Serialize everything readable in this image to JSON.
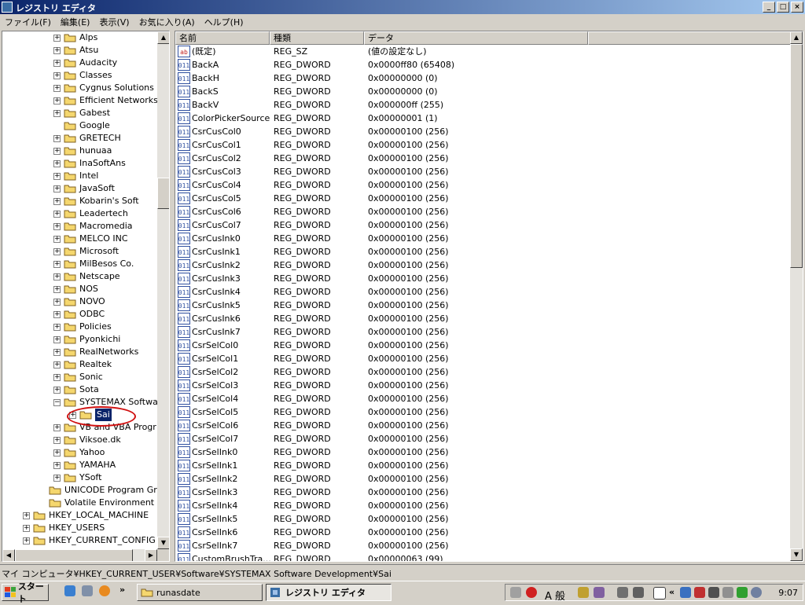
{
  "window": {
    "title": "レジストリ エディタ",
    "controls": [
      "_",
      "□",
      "×"
    ]
  },
  "menu": [
    "ファイル(F)",
    "編集(E)",
    "表示(V)",
    "お気に入り(A)",
    "ヘルプ(H)"
  ],
  "tree": {
    "items": [
      {
        "label": "Alps",
        "expandable": true
      },
      {
        "label": "Atsu",
        "expandable": true
      },
      {
        "label": "Audacity",
        "expandable": true
      },
      {
        "label": "Classes",
        "expandable": true
      },
      {
        "label": "Cygnus Solutions",
        "expandable": true
      },
      {
        "label": "Efficient Networks",
        "expandable": true
      },
      {
        "label": "Gabest",
        "expandable": true
      },
      {
        "label": "Google",
        "expandable": false
      },
      {
        "label": "GRETECH",
        "expandable": true
      },
      {
        "label": "hunuaa",
        "expandable": true
      },
      {
        "label": "InaSoftAns",
        "expandable": true
      },
      {
        "label": "Intel",
        "expandable": true
      },
      {
        "label": "JavaSoft",
        "expandable": true
      },
      {
        "label": "Kobarin's Soft",
        "expandable": true
      },
      {
        "label": "Leadertech",
        "expandable": true
      },
      {
        "label": "Macromedia",
        "expandable": true
      },
      {
        "label": "MELCO INC",
        "expandable": true
      },
      {
        "label": "Microsoft",
        "expandable": true
      },
      {
        "label": "MilBesos Co.",
        "expandable": true
      },
      {
        "label": "Netscape",
        "expandable": true
      },
      {
        "label": "NOS",
        "expandable": true
      },
      {
        "label": "NOVO",
        "expandable": true
      },
      {
        "label": "ODBC",
        "expandable": true
      },
      {
        "label": "Policies",
        "expandable": true
      },
      {
        "label": "Pyonkichi",
        "expandable": true
      },
      {
        "label": "RealNetworks",
        "expandable": true
      },
      {
        "label": "Realtek",
        "expandable": true
      },
      {
        "label": "Sonic",
        "expandable": true
      },
      {
        "label": "Sota",
        "expandable": true
      },
      {
        "label": "SYSTEMAX Softwa",
        "expandable": true,
        "expanded": true
      },
      {
        "label": "Sai",
        "expandable": true,
        "selected": true,
        "child": true
      },
      {
        "label": "VB and VBA Progr",
        "expandable": true
      },
      {
        "label": "Viksoe.dk",
        "expandable": true
      },
      {
        "label": "Yahoo",
        "expandable": true
      },
      {
        "label": "YAMAHA",
        "expandable": true
      },
      {
        "label": "YSoft",
        "expandable": true
      },
      {
        "label": "UNICODE Program Gro",
        "expandable": false,
        "level": 1
      },
      {
        "label": "Volatile Environment",
        "expandable": false,
        "level": 1
      },
      {
        "label": "HKEY_LOCAL_MACHINE",
        "expandable": true,
        "level": 0
      },
      {
        "label": "HKEY_USERS",
        "expandable": true,
        "level": 0
      },
      {
        "label": "HKEY_CURRENT_CONFIG",
        "expandable": true,
        "level": 0
      }
    ]
  },
  "columns": [
    "名前",
    "種類",
    "データ"
  ],
  "values": [
    {
      "name": "(既定)",
      "type": "REG_SZ",
      "data": "(値の設定なし)",
      "kind": "string"
    },
    {
      "name": "BackA",
      "type": "REG_DWORD",
      "data": "0x0000ff80 (65408)"
    },
    {
      "name": "BackH",
      "type": "REG_DWORD",
      "data": "0x00000000 (0)"
    },
    {
      "name": "BackS",
      "type": "REG_DWORD",
      "data": "0x00000000 (0)"
    },
    {
      "name": "BackV",
      "type": "REG_DWORD",
      "data": "0x000000ff (255)"
    },
    {
      "name": "ColorPickerSource",
      "type": "REG_DWORD",
      "data": "0x00000001 (1)"
    },
    {
      "name": "CsrCusCol0",
      "type": "REG_DWORD",
      "data": "0x00000100 (256)"
    },
    {
      "name": "CsrCusCol1",
      "type": "REG_DWORD",
      "data": "0x00000100 (256)"
    },
    {
      "name": "CsrCusCol2",
      "type": "REG_DWORD",
      "data": "0x00000100 (256)"
    },
    {
      "name": "CsrCusCol3",
      "type": "REG_DWORD",
      "data": "0x00000100 (256)"
    },
    {
      "name": "CsrCusCol4",
      "type": "REG_DWORD",
      "data": "0x00000100 (256)"
    },
    {
      "name": "CsrCusCol5",
      "type": "REG_DWORD",
      "data": "0x00000100 (256)"
    },
    {
      "name": "CsrCusCol6",
      "type": "REG_DWORD",
      "data": "0x00000100 (256)"
    },
    {
      "name": "CsrCusCol7",
      "type": "REG_DWORD",
      "data": "0x00000100 (256)"
    },
    {
      "name": "CsrCusInk0",
      "type": "REG_DWORD",
      "data": "0x00000100 (256)"
    },
    {
      "name": "CsrCusInk1",
      "type": "REG_DWORD",
      "data": "0x00000100 (256)"
    },
    {
      "name": "CsrCusInk2",
      "type": "REG_DWORD",
      "data": "0x00000100 (256)"
    },
    {
      "name": "CsrCusInk3",
      "type": "REG_DWORD",
      "data": "0x00000100 (256)"
    },
    {
      "name": "CsrCusInk4",
      "type": "REG_DWORD",
      "data": "0x00000100 (256)"
    },
    {
      "name": "CsrCusInk5",
      "type": "REG_DWORD",
      "data": "0x00000100 (256)"
    },
    {
      "name": "CsrCusInk6",
      "type": "REG_DWORD",
      "data": "0x00000100 (256)"
    },
    {
      "name": "CsrCusInk7",
      "type": "REG_DWORD",
      "data": "0x00000100 (256)"
    },
    {
      "name": "CsrSelCol0",
      "type": "REG_DWORD",
      "data": "0x00000100 (256)"
    },
    {
      "name": "CsrSelCol1",
      "type": "REG_DWORD",
      "data": "0x00000100 (256)"
    },
    {
      "name": "CsrSelCol2",
      "type": "REG_DWORD",
      "data": "0x00000100 (256)"
    },
    {
      "name": "CsrSelCol3",
      "type": "REG_DWORD",
      "data": "0x00000100 (256)"
    },
    {
      "name": "CsrSelCol4",
      "type": "REG_DWORD",
      "data": "0x00000100 (256)"
    },
    {
      "name": "CsrSelCol5",
      "type": "REG_DWORD",
      "data": "0x00000100 (256)"
    },
    {
      "name": "CsrSelCol6",
      "type": "REG_DWORD",
      "data": "0x00000100 (256)"
    },
    {
      "name": "CsrSelCol7",
      "type": "REG_DWORD",
      "data": "0x00000100 (256)"
    },
    {
      "name": "CsrSelInk0",
      "type": "REG_DWORD",
      "data": "0x00000100 (256)"
    },
    {
      "name": "CsrSelInk1",
      "type": "REG_DWORD",
      "data": "0x00000100 (256)"
    },
    {
      "name": "CsrSelInk2",
      "type": "REG_DWORD",
      "data": "0x00000100 (256)"
    },
    {
      "name": "CsrSelInk3",
      "type": "REG_DWORD",
      "data": "0x00000100 (256)"
    },
    {
      "name": "CsrSelInk4",
      "type": "REG_DWORD",
      "data": "0x00000100 (256)"
    },
    {
      "name": "CsrSelInk5",
      "type": "REG_DWORD",
      "data": "0x00000100 (256)"
    },
    {
      "name": "CsrSelInk6",
      "type": "REG_DWORD",
      "data": "0x00000100 (256)"
    },
    {
      "name": "CsrSelInk7",
      "type": "REG_DWORD",
      "data": "0x00000100 (256)"
    },
    {
      "name": "CustomBrushTra...",
      "type": "REG_DWORD",
      "data": "0x00000063 (99)"
    }
  ],
  "statusbar": "マイ コンピュータ¥HKEY_CURRENT_USER¥Software¥SYSTEMAX Software Development¥Sai",
  "taskbar": {
    "start": "スタート",
    "quicklaunch_more": "»",
    "tasks": [
      {
        "label": "runasdate",
        "active": false
      },
      {
        "label": "レジストリ エディタ",
        "active": true
      }
    ],
    "tray": {
      "ime": "A 般",
      "chevron": "«",
      "clock": "9:07"
    }
  },
  "colors": {
    "selection": "#0a246a",
    "annotation": "#d01010",
    "folder": "#f5d76e"
  }
}
